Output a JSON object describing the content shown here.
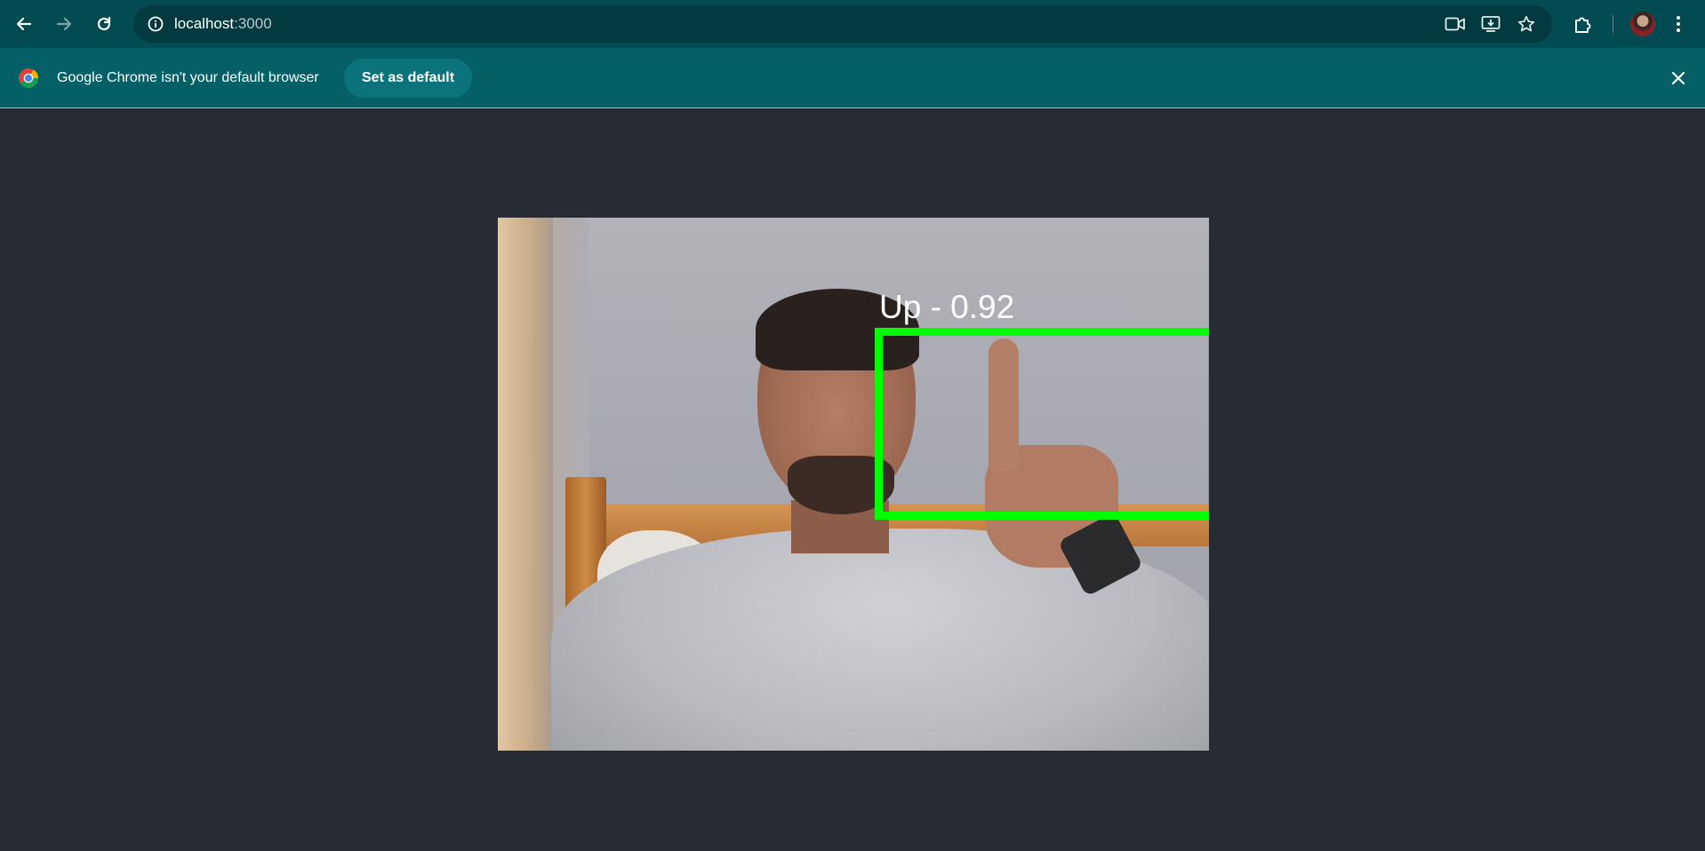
{
  "browser": {
    "url_host": "localhost",
    "url_port": ":3000",
    "icons": [
      "back-icon",
      "forward-icon",
      "reload-icon",
      "site-info-icon",
      "camera-icon",
      "install-app-icon",
      "bookmark-star-icon",
      "extensions-icon",
      "profile-avatar",
      "menu-kebab-icon"
    ]
  },
  "infobar": {
    "message": "Google Chrome isn't your default browser",
    "button_label": "Set as default"
  },
  "detection": {
    "label": "Up - 0.92",
    "box_color": "#00ff00"
  },
  "colors": {
    "toolbar": "#034b52",
    "infobar": "#045f66",
    "page_background": "#272b34"
  }
}
